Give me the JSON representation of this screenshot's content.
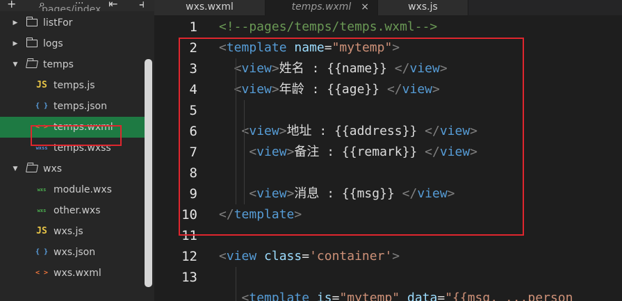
{
  "sidebar": {
    "toolbar": {
      "icons": [
        "plus-icon",
        "search-icon",
        "more-icon",
        "outline-icon",
        "split-icon"
      ],
      "glyphs": [
        "+",
        "⌕",
        "···",
        "⇤",
        "⫞"
      ],
      "cut_label": "pages/index"
    },
    "tree": [
      {
        "type": "folder",
        "label": "listFor",
        "open": false
      },
      {
        "type": "folder",
        "label": "logs",
        "open": false
      },
      {
        "type": "folder",
        "label": "temps",
        "open": true
      },
      {
        "type": "file",
        "icon": "JS",
        "label": "temps.js",
        "color": "#e8c547"
      },
      {
        "type": "file",
        "icon": "{ }",
        "label": "temps.json",
        "color": "#5aa0e0"
      },
      {
        "type": "file",
        "icon": "< >",
        "label": "temps.wxml",
        "color": "#e8723a",
        "selected": true
      },
      {
        "type": "file",
        "icon": "wxss",
        "label": "temps.wxss",
        "color": "#5a8ee0"
      },
      {
        "type": "folder",
        "label": "wxs",
        "open": true
      },
      {
        "type": "file",
        "icon": "wxs",
        "label": "module.wxs",
        "color": "#4caf50"
      },
      {
        "type": "file",
        "icon": "wxs",
        "label": "other.wxs",
        "color": "#4caf50"
      },
      {
        "type": "file",
        "icon": "JS",
        "label": "wxs.js",
        "color": "#e8c547"
      },
      {
        "type": "file",
        "icon": "{ }",
        "label": "wxs.json",
        "color": "#5aa0e0"
      },
      {
        "type": "file",
        "icon": "< >",
        "label": "wxs.wxml",
        "color": "#e8723a"
      }
    ]
  },
  "tabs": [
    {
      "label": "wxs.wxml",
      "active": false
    },
    {
      "label": "temps.wxml",
      "active": true,
      "close": "×"
    },
    {
      "label": "wxs.js",
      "active": false
    }
  ],
  "colors": {
    "highlight": "#e0262e",
    "selected_row": "#1e7a43",
    "tag": "#569cd6",
    "attr": "#9cdcfe",
    "string": "#ce9178",
    "comment": "#6a9955"
  },
  "code": {
    "line_numbers": [
      "1",
      "2",
      "3",
      "4",
      "5",
      "6",
      "7",
      "8",
      "9",
      "10",
      "11",
      "12",
      "13",
      ""
    ],
    "lines": [
      [
        {
          "t": "comment",
          "v": "<!--pages/temps/temps.wxml-->"
        }
      ],
      [
        {
          "t": "punct",
          "v": "<"
        },
        {
          "t": "tag",
          "v": "template"
        },
        {
          "t": "text",
          "v": " "
        },
        {
          "t": "attr",
          "v": "name"
        },
        {
          "t": "text",
          "v": "="
        },
        {
          "t": "str",
          "v": "\"mytemp\""
        },
        {
          "t": "punct",
          "v": ">"
        }
      ],
      [
        {
          "t": "text",
          "v": "  "
        },
        {
          "t": "punct",
          "v": "<"
        },
        {
          "t": "tag",
          "v": "view"
        },
        {
          "t": "punct",
          "v": ">"
        },
        {
          "t": "text",
          "v": "姓名 : {{name}} "
        },
        {
          "t": "punct",
          "v": "</"
        },
        {
          "t": "tag",
          "v": "view"
        },
        {
          "t": "punct",
          "v": ">"
        }
      ],
      [
        {
          "t": "text",
          "v": "  "
        },
        {
          "t": "punct",
          "v": "<"
        },
        {
          "t": "tag",
          "v": "view"
        },
        {
          "t": "punct",
          "v": ">"
        },
        {
          "t": "text",
          "v": "年龄 : {{age}} "
        },
        {
          "t": "punct",
          "v": "</"
        },
        {
          "t": "tag",
          "v": "view"
        },
        {
          "t": "punct",
          "v": ">"
        }
      ],
      [],
      [
        {
          "t": "text",
          "v": "   "
        },
        {
          "t": "punct",
          "v": "<"
        },
        {
          "t": "tag",
          "v": "view"
        },
        {
          "t": "punct",
          "v": ">"
        },
        {
          "t": "text",
          "v": "地址 : {{address}} "
        },
        {
          "t": "punct",
          "v": "</"
        },
        {
          "t": "tag",
          "v": "view"
        },
        {
          "t": "punct",
          "v": ">"
        }
      ],
      [
        {
          "t": "text",
          "v": "    "
        },
        {
          "t": "punct",
          "v": "<"
        },
        {
          "t": "tag",
          "v": "view"
        },
        {
          "t": "punct",
          "v": ">"
        },
        {
          "t": "text",
          "v": "备注 : {{remark}} "
        },
        {
          "t": "punct",
          "v": "</"
        },
        {
          "t": "tag",
          "v": "view"
        },
        {
          "t": "punct",
          "v": ">"
        }
      ],
      [],
      [
        {
          "t": "text",
          "v": "    "
        },
        {
          "t": "punct",
          "v": "<"
        },
        {
          "t": "tag",
          "v": "view"
        },
        {
          "t": "punct",
          "v": ">"
        },
        {
          "t": "text",
          "v": "消息 : {{msg}} "
        },
        {
          "t": "punct",
          "v": "</"
        },
        {
          "t": "tag",
          "v": "view"
        },
        {
          "t": "punct",
          "v": ">"
        }
      ],
      [
        {
          "t": "punct",
          "v": "</"
        },
        {
          "t": "tag",
          "v": "template"
        },
        {
          "t": "punct",
          "v": ">"
        }
      ],
      [],
      [
        {
          "t": "punct",
          "v": "<"
        },
        {
          "t": "tag",
          "v": "view"
        },
        {
          "t": "text",
          "v": " "
        },
        {
          "t": "attr",
          "v": "class"
        },
        {
          "t": "text",
          "v": "="
        },
        {
          "t": "str",
          "v": "'container'"
        },
        {
          "t": "punct",
          "v": ">"
        }
      ],
      [],
      [
        {
          "t": "text",
          "v": "   "
        },
        {
          "t": "punct",
          "v": "<"
        },
        {
          "t": "tag",
          "v": "template"
        },
        {
          "t": "text",
          "v": " "
        },
        {
          "t": "attr",
          "v": "is"
        },
        {
          "t": "text",
          "v": "="
        },
        {
          "t": "str",
          "v": "\"mytemp\""
        },
        {
          "t": "text",
          "v": " "
        },
        {
          "t": "attr",
          "v": "data"
        },
        {
          "t": "text",
          "v": "="
        },
        {
          "t": "str",
          "v": "\"{{msg, ...person"
        }
      ]
    ]
  }
}
